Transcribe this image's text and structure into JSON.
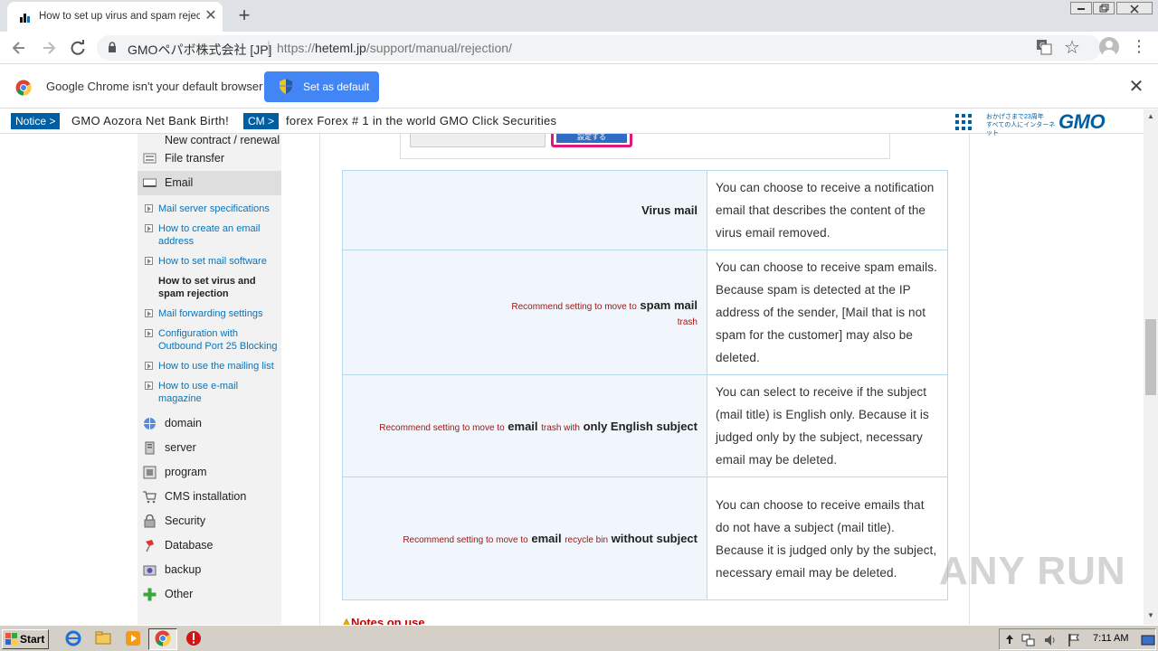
{
  "browser": {
    "tab_title": "How to set up virus and spam rejection",
    "new_tab": "+",
    "tab_close": "✕",
    "site_identity": "GMOペパボ株式会社 [JP]",
    "url_scheme": "https://",
    "url_host": "heteml.jp",
    "url_path": "/support/manual/rejection/",
    "infobar_message": "Google Chrome isn't your default browser",
    "set_default_label": "Set as default",
    "infobar_close": "✕"
  },
  "notice_bar": {
    "badge1": "Notice >",
    "text1": "GMO Aozora Net Bank Birth!",
    "badge2": "CM >",
    "text2": "forex Forex # 1 in the world GMO Click Securities",
    "slogan_line1": "おかげさまで23周年",
    "slogan_line2": "すべての人にインターネット",
    "logo": "GMO"
  },
  "sidebar": {
    "top_partial": "New contract / renewal",
    "items": [
      {
        "label": "File transfer"
      },
      {
        "label": "Email"
      }
    ],
    "email_sub": [
      "Mail server specifications",
      "How to create an email address",
      "How to set mail software",
      "How to set virus and spam rejection",
      "Mail forwarding settings",
      "Configuration with Outbound Port 25 Blocking",
      "How to use the mailing list",
      "How to use e-mail magazine"
    ],
    "bottom_items": [
      {
        "label": "domain"
      },
      {
        "label": "server"
      },
      {
        "label": "program"
      },
      {
        "label": "CMS installation"
      },
      {
        "label": "Security"
      },
      {
        "label": "Database"
      },
      {
        "label": "backup"
      },
      {
        "label": "Other"
      }
    ]
  },
  "content": {
    "screenshot_button": "設定する",
    "rows": [
      {
        "label_main": "Virus mail",
        "desc": "You can choose to receive a notification email that describes the content of the virus email removed."
      },
      {
        "label_red1": "Recommend setting to move to",
        "label_main": "spam mail",
        "label_red2": "trash",
        "desc": "You can choose to receive spam emails. Because spam is detected at the IP address of the sender, [Mail that is not spam for the customer] may also be deleted."
      },
      {
        "label_red1": "Recommend setting to move to",
        "label_main": "email",
        "label_red2": "trash with",
        "label_main2": "only English subject",
        "desc": "You can select to receive if the subject (mail title) is English only. Because it is judged only by the subject, necessary email may be deleted."
      },
      {
        "label_red1": "Recommend setting to move to",
        "label_main": "email",
        "label_red2": "recycle bin",
        "label_main2": "without subject",
        "desc": "You can choose to receive emails that do not have a subject (mail title). Because it is judged only by the subject, necessary email may be deleted."
      }
    ],
    "notes_heading": "Notes on use"
  },
  "watermark": "ANY RUN",
  "taskbar": {
    "start_label": "Start",
    "clock": "7:11 AM"
  },
  "colors": {
    "accent_blue": "#4285f4",
    "gmo_blue": "#005fa3",
    "link_blue": "#0a73b8",
    "recommend_red": "#a31515",
    "table_border": "#b8d8ec"
  }
}
